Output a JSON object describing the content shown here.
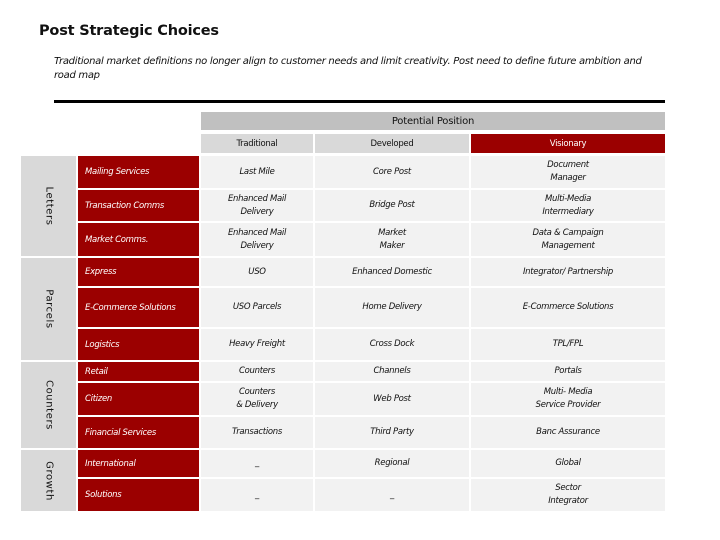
{
  "title": "Post Strategic Choices",
  "subtitle": "Traditional market definitions no longer align to customer needs and limit creativity. Post need to define future ambition and  road map",
  "table": {
    "potential_position_label": "Potential Position",
    "columns": [
      "Traditional",
      "Developed",
      "Visionary"
    ],
    "groups": [
      {
        "label": "Letters",
        "rows": [
          {
            "label": "Mailing Services",
            "cells": [
              "Last Mile",
              "Core Post",
              "Document\nManager"
            ]
          },
          {
            "label": "Transaction Comms",
            "cells": [
              "Enhanced Mail\nDelivery",
              "Bridge Post",
              "Multi-Media\nIntermediary"
            ]
          },
          {
            "label": "Market Comms.",
            "cells": [
              "Enhanced Mail\nDelivery",
              "Market\nMaker",
              "Data & Campaign\nManagement"
            ]
          }
        ]
      },
      {
        "label": "Parcels",
        "rows": [
          {
            "label": "Express",
            "cells": [
              "USO",
              "Enhanced Domestic",
              "Integrator/ Partnership"
            ]
          },
          {
            "label": "E-Commerce Solutions",
            "cells": [
              "USO Parcels",
              "Home Delivery",
              "E-Commerce Solutions"
            ]
          },
          {
            "label": "Logistics",
            "cells": [
              "Heavy Freight",
              "Cross Dock",
              "TPL/FPL"
            ]
          }
        ]
      },
      {
        "label": "Counters",
        "rows": [
          {
            "label": "Retail",
            "cells": [
              "Counters",
              "Channels",
              "Portals"
            ]
          },
          {
            "label": "Citizen",
            "cells": [
              "Counters\n& Delivery",
              "Web Post",
              "Multi- Media\nService Provider"
            ]
          },
          {
            "label": "Financial Services",
            "cells": [
              "Transactions",
              "Third Party",
              "Banc Assurance"
            ]
          }
        ]
      },
      {
        "label": "Growth",
        "rows": [
          {
            "label": "International",
            "cells": [
              "_",
              "Regional",
              "Global"
            ]
          },
          {
            "label": "Solutions",
            "cells": [
              "_",
              "_",
              "Sector\nIntegrator"
            ]
          }
        ]
      }
    ]
  },
  "colors": {
    "accent_red": "#9b0000",
    "header_gray": "#c0c0c0",
    "subheader_gray": "#d9d9d9",
    "cell_gray": "#f2f2f2"
  }
}
